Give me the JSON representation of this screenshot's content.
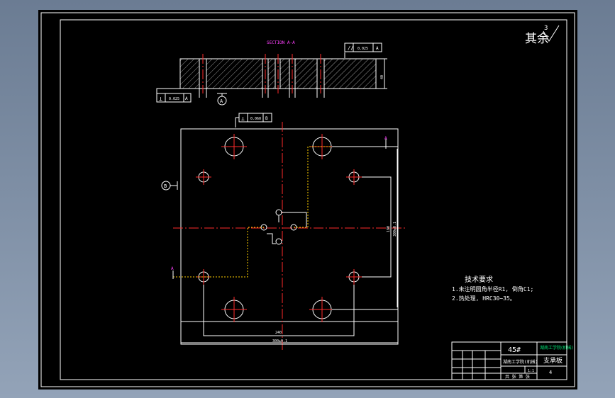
{
  "drawing": {
    "section_label": "SECTION A-A",
    "roughness_note_text": "其余",
    "roughness_value": "3",
    "tol_parallel_value": "0.025",
    "tol_parallel_datum": "A",
    "tol_perp_left_value": "0.025",
    "tol_perp_left_datum": "A",
    "tol_perp_plate_value": "0.060",
    "tol_perp_plate_datum": "B",
    "datum_a": "A",
    "datum_b": "B",
    "cut_label_a1": "A",
    "cut_label_a2": "A",
    "tech_title": "技术要求",
    "tech_line1": "1.未注明圆角半径R1, 倒角C1;",
    "tech_line2": "2.热处理, HRC30~35。",
    "dim_h1": "240",
    "dim_h2": "300±0.1",
    "dim_v1": "180",
    "dim_v2": "300±0.1",
    "dim_section_h": "40"
  },
  "title_block": {
    "material": "45#",
    "company": "湖南工学院(机械)",
    "part_name": "支承板",
    "drawing_no": "4",
    "scale": "1:1",
    "sheet_info": "共 张 第 张"
  },
  "colors": {
    "background": "#000000",
    "outline": "#ffffff",
    "centerline": "#ff2a2a",
    "hidden": "#ffd000",
    "annotation": "#ff40ff",
    "stamp": "#00e676"
  }
}
